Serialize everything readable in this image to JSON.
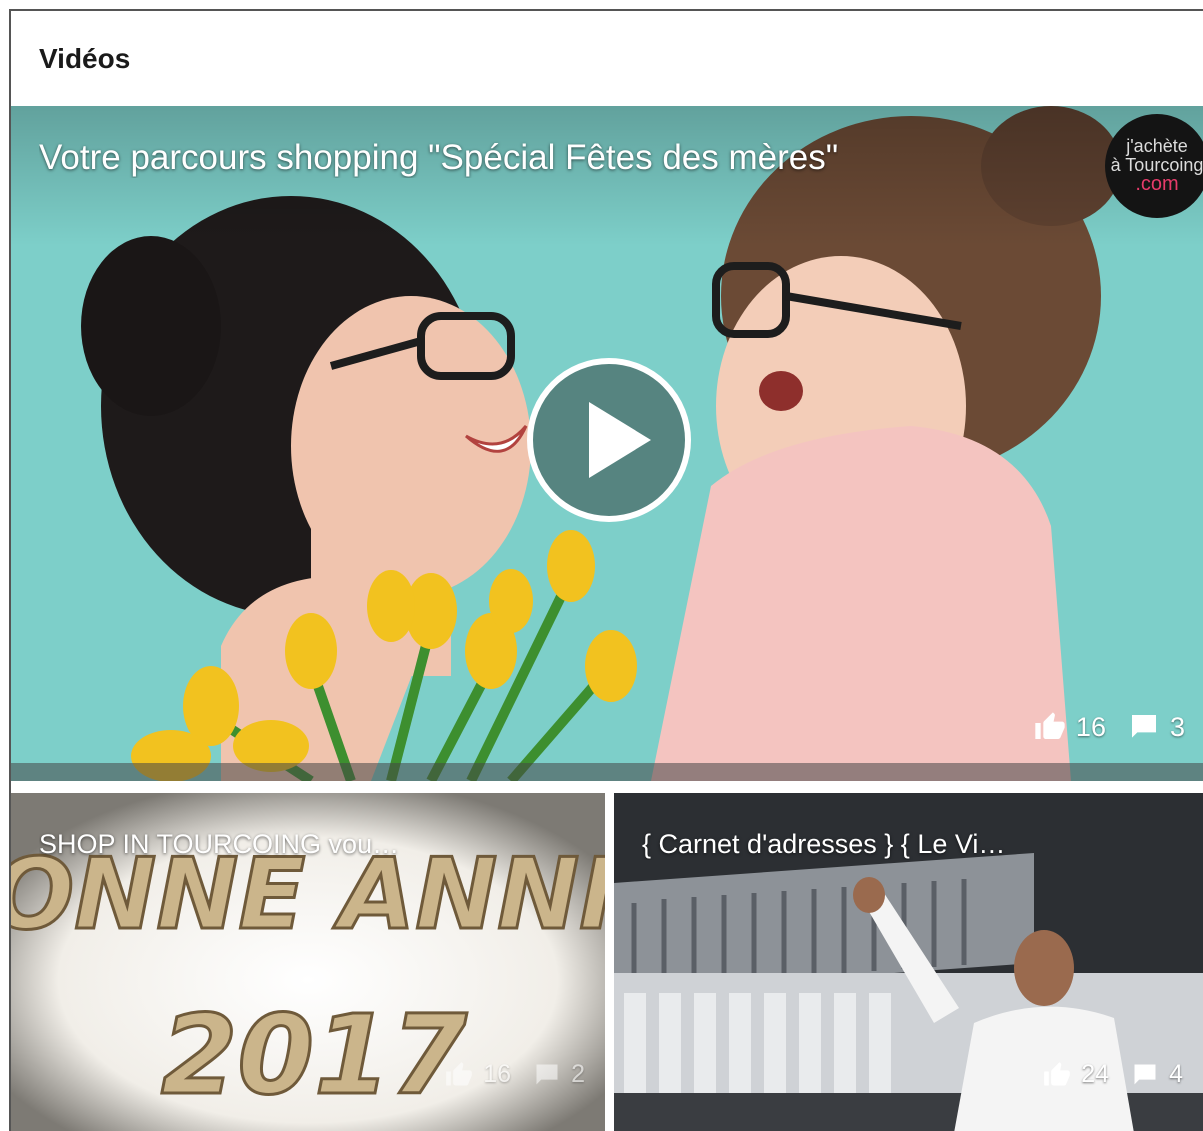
{
  "panel": {
    "title": "Vidéos"
  },
  "featured": {
    "title": "Votre parcours shopping \"Spécial Fêtes des mères\"",
    "likes": "16",
    "comments": "3",
    "badge": {
      "line1": "j'achète",
      "line2": "à Tourcoing",
      "line3": ".com"
    },
    "thumbnail_icon": "mother-daughter-photo"
  },
  "videos": [
    {
      "title": "SHOP IN TOURCOING vou…",
      "likes": "16",
      "comments": "2",
      "thumbnail_text_1": "ONNE ANNI",
      "thumbnail_text_2": "2017"
    },
    {
      "title": "{ Carnet d'adresses } { Le Vi…",
      "likes": "24",
      "comments": "4",
      "thumbnail_icon": "chef-kitchen-photo"
    }
  ],
  "icons": {
    "like": "thumbs-up-icon",
    "comment": "comment-icon",
    "play": "play-icon"
  },
  "colors": {
    "featured_background": "#7ccfc8",
    "badge_accent": "#e63b6a",
    "text_on_media": "#ffffff"
  }
}
